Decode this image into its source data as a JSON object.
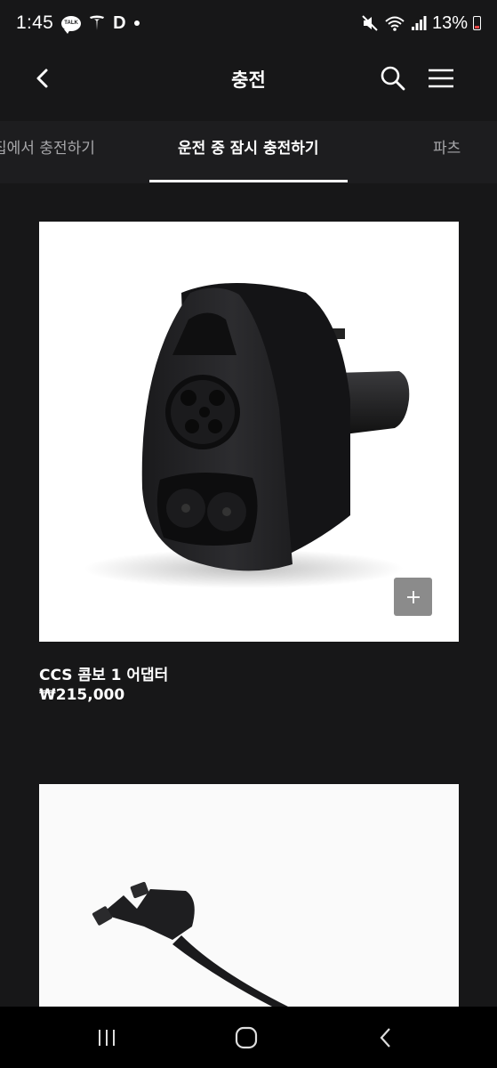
{
  "status_bar": {
    "time": "1:45",
    "talk_icon_text": "TALK",
    "d_icon_text": "D",
    "battery": "13%"
  },
  "header": {
    "title": "충전"
  },
  "tabs": [
    {
      "label": "집에서 충전하기",
      "active": false
    },
    {
      "label": "운전 중 잠시 충전하기",
      "active": true
    },
    {
      "label": "파츠",
      "active": false
    }
  ],
  "products": [
    {
      "name": "CCS 콤보 1 어댑터",
      "price": "₩215,000",
      "image_icon": "ccs-adapter-image"
    },
    {
      "name": "",
      "price": "",
      "image_icon": "charging-cable-image"
    }
  ],
  "colors": {
    "background": "#171718",
    "tab_bar": "#1d1d1f",
    "inactive_tab": "#a7a7aa",
    "add_button": "#8b8b8b"
  }
}
